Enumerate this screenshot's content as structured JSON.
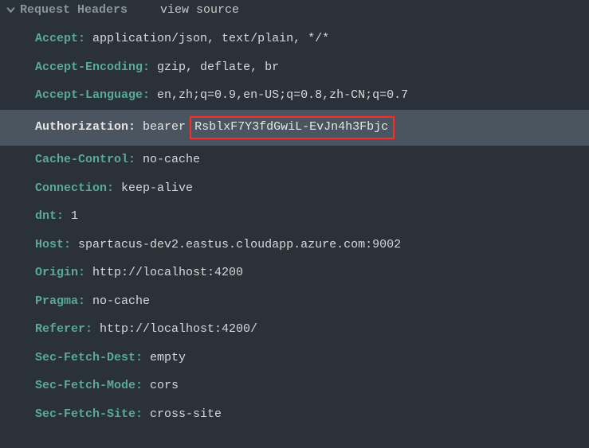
{
  "section": {
    "title": "Request Headers",
    "view_source": "view source"
  },
  "highlighted_index": 3,
  "headers": [
    {
      "key": "Accept",
      "value": "application/json, text/plain, */*"
    },
    {
      "key": "Accept-Encoding",
      "value": "gzip, deflate, br"
    },
    {
      "key": "Accept-Language",
      "value": "en,zh;q=0.9,en-US;q=0.8,zh-CN;q=0.7"
    },
    {
      "key": "Authorization",
      "value_prefix": "bearer",
      "value_boxed": "RsblxF7Y3fdGwiL-EvJn4h3Fbjc"
    },
    {
      "key": "Cache-Control",
      "value": "no-cache"
    },
    {
      "key": "Connection",
      "value": "keep-alive"
    },
    {
      "key": "dnt",
      "value": "1"
    },
    {
      "key": "Host",
      "value": "spartacus-dev2.eastus.cloudapp.azure.com:9002"
    },
    {
      "key": "Origin",
      "value": "http://localhost:4200"
    },
    {
      "key": "Pragma",
      "value": "no-cache"
    },
    {
      "key": "Referer",
      "value": "http://localhost:4200/"
    },
    {
      "key": "Sec-Fetch-Dest",
      "value": "empty"
    },
    {
      "key": "Sec-Fetch-Mode",
      "value": "cors"
    },
    {
      "key": "Sec-Fetch-Site",
      "value": "cross-site"
    }
  ]
}
